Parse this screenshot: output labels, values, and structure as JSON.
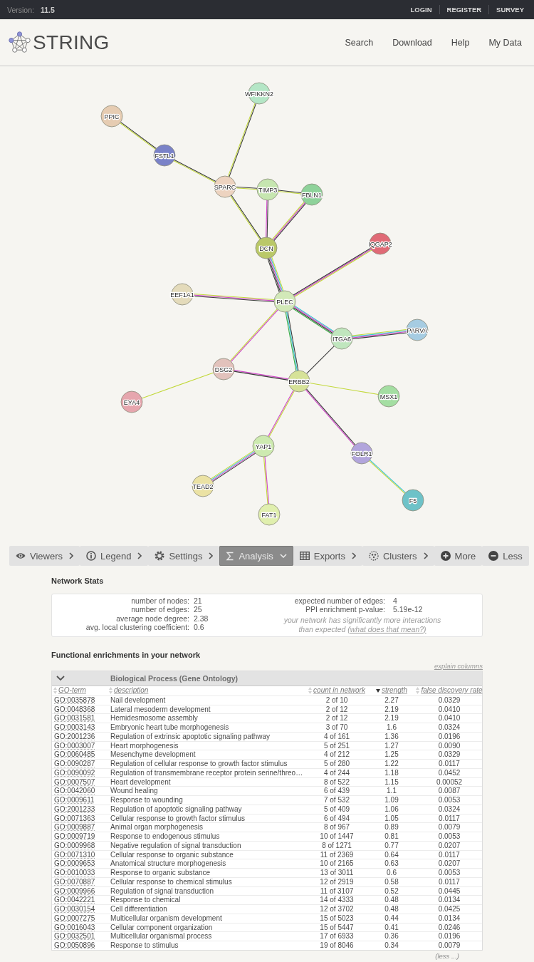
{
  "top_bar": {
    "version_label": "Version:",
    "version": "11.5",
    "links": [
      "LOGIN",
      "REGISTER",
      "SURVEY"
    ]
  },
  "header": {
    "logo": "STRING",
    "nav": [
      "Search",
      "Download",
      "Help",
      "My Data"
    ]
  },
  "network": {
    "nodes": [
      {
        "label": "WFIKKN2",
        "color": "#b4e6c6"
      },
      {
        "label": "PPIC",
        "color": "#e6ccb2"
      },
      {
        "label": "FSTL1",
        "color": "#7a82c8"
      },
      {
        "label": "SPARC",
        "color": "#edd3c0"
      },
      {
        "label": "TIMP3",
        "color": "#c6e6b0"
      },
      {
        "label": "FBLN1",
        "color": "#8ed29a"
      },
      {
        "label": "DCN",
        "color": "#bac868"
      },
      {
        "label": "IQGAP2",
        "color": "#e06a76"
      },
      {
        "label": "EEF1A1",
        "color": "#e4dbbb"
      },
      {
        "label": "PLEC",
        "color": "#d2e9b8"
      },
      {
        "label": "PARVA",
        "color": "#a6cce2"
      },
      {
        "label": "ITGA6",
        "color": "#c0e6be"
      },
      {
        "label": "DSG2",
        "color": "#e2c2bc"
      },
      {
        "label": "ERBB2",
        "color": "#d6e298"
      },
      {
        "label": "EYA4",
        "color": "#e6a6ae"
      },
      {
        "label": "MSX1",
        "color": "#a4dea2"
      },
      {
        "label": "YAP1",
        "color": "#cdeab0"
      },
      {
        "label": "FOLR1",
        "color": "#b2a5dc"
      },
      {
        "label": "TEAD2",
        "color": "#ebe2a4"
      },
      {
        "label": "F5",
        "color": "#6ec2c8"
      },
      {
        "label": "FAT1",
        "color": "#e0efae"
      }
    ]
  },
  "toolbar": {
    "buttons": [
      {
        "label": "Viewers",
        "kind": "menu",
        "selected": false
      },
      {
        "label": "Legend",
        "kind": "menu",
        "selected": false
      },
      {
        "label": "Settings",
        "kind": "menu",
        "selected": false
      },
      {
        "label": "Analysis",
        "kind": "menu",
        "selected": true
      },
      {
        "label": "Exports",
        "kind": "menu",
        "selected": false
      },
      {
        "label": "Clusters",
        "kind": "menu",
        "selected": false
      },
      {
        "label": "More",
        "kind": "action",
        "selected": false
      },
      {
        "label": "Less",
        "kind": "action",
        "selected": false
      }
    ]
  },
  "network_stats": {
    "title": "Network Stats",
    "left": [
      {
        "label": "number of nodes:",
        "value": "21"
      },
      {
        "label": "number of edges:",
        "value": "25"
      },
      {
        "label": "average node degree:",
        "value": "2.38"
      },
      {
        "label": "avg. local clustering coefficient:",
        "value": "0.6"
      }
    ],
    "right": [
      {
        "label": "expected number of edges:",
        "value": "4"
      },
      {
        "label": "PPI enrichment p-value:",
        "value": "5.19e-12"
      }
    ],
    "note": "your network has significantly more interactions than expected",
    "note_link": "(what does that mean?)"
  },
  "enrichments": {
    "title": "Functional enrichments in your network",
    "explain_link": "explain columns",
    "category": {
      "title": "Biological Process (Gene Ontology)",
      "expanded": true
    },
    "columns": [
      {
        "label": "GO-term",
        "sorted": false
      },
      {
        "label": "description",
        "sorted": false
      },
      {
        "label": "count in network",
        "sorted": false
      },
      {
        "label": "strength",
        "sorted": true
      },
      {
        "label": "false discovery rate",
        "sorted": false
      }
    ],
    "rows": [
      {
        "term": "GO:0035878",
        "description": "Nail development",
        "count": "2 of 10",
        "strength": "2.27",
        "fdr": "0.0329"
      },
      {
        "term": "GO:0048368",
        "description": "Lateral mesoderm development",
        "count": "2 of 12",
        "strength": "2.19",
        "fdr": "0.0410"
      },
      {
        "term": "GO:0031581",
        "description": "Hemidesmosome assembly",
        "count": "2 of 12",
        "strength": "2.19",
        "fdr": "0.0410"
      },
      {
        "term": "GO:0003143",
        "description": "Embryonic heart tube morphogenesis",
        "count": "3 of 70",
        "strength": "1.6",
        "fdr": "0.0324"
      },
      {
        "term": "GO:2001236",
        "description": "Regulation of extrinsic apoptotic signaling pathway",
        "count": "4 of 161",
        "strength": "1.36",
        "fdr": "0.0196"
      },
      {
        "term": "GO:0003007",
        "description": "Heart morphogenesis",
        "count": "5 of 251",
        "strength": "1.27",
        "fdr": "0.0090"
      },
      {
        "term": "GO:0060485",
        "description": "Mesenchyme development",
        "count": "4 of 212",
        "strength": "1.25",
        "fdr": "0.0329"
      },
      {
        "term": "GO:0090287",
        "description": "Regulation of cellular response to growth factor stimulus",
        "count": "5 of 280",
        "strength": "1.22",
        "fdr": "0.0117"
      },
      {
        "term": "GO:0090092",
        "description": "Regulation of transmembrane receptor protein serine/threo…",
        "count": "4 of 244",
        "strength": "1.18",
        "fdr": "0.0452"
      },
      {
        "term": "GO:0007507",
        "description": "Heart development",
        "count": "8 of 522",
        "strength": "1.15",
        "fdr": "0.00052"
      },
      {
        "term": "GO:0042060",
        "description": "Wound healing",
        "count": "6 of 439",
        "strength": "1.1",
        "fdr": "0.0087"
      },
      {
        "term": "GO:0009611",
        "description": "Response to wounding",
        "count": "7 of 532",
        "strength": "1.09",
        "fdr": "0.0053"
      },
      {
        "term": "GO:2001233",
        "description": "Regulation of apoptotic signaling pathway",
        "count": "5 of 409",
        "strength": "1.06",
        "fdr": "0.0324"
      },
      {
        "term": "GO:0071363",
        "description": "Cellular response to growth factor stimulus",
        "count": "6 of 494",
        "strength": "1.05",
        "fdr": "0.0117"
      },
      {
        "term": "GO:0009887",
        "description": "Animal organ morphogenesis",
        "count": "8 of 967",
        "strength": "0.89",
        "fdr": "0.0079"
      },
      {
        "term": "GO:0009719",
        "description": "Response to endogenous stimulus",
        "count": "10 of 1447",
        "strength": "0.81",
        "fdr": "0.0053"
      },
      {
        "term": "GO:0009968",
        "description": "Negative regulation of signal transduction",
        "count": "8 of 1271",
        "strength": "0.77",
        "fdr": "0.0207"
      },
      {
        "term": "GO:0071310",
        "description": "Cellular response to organic substance",
        "count": "11 of 2369",
        "strength": "0.64",
        "fdr": "0.0117"
      },
      {
        "term": "GO:0009653",
        "description": "Anatomical structure morphogenesis",
        "count": "10 of 2165",
        "strength": "0.63",
        "fdr": "0.0207"
      },
      {
        "term": "GO:0010033",
        "description": "Response to organic substance",
        "count": "13 of 3011",
        "strength": "0.6",
        "fdr": "0.0053"
      },
      {
        "term": "GO:0070887",
        "description": "Cellular response to chemical stimulus",
        "count": "12 of 2919",
        "strength": "0.58",
        "fdr": "0.0117"
      },
      {
        "term": "GO:0009966",
        "description": "Regulation of signal transduction",
        "count": "11 of 3107",
        "strength": "0.52",
        "fdr": "0.0445"
      },
      {
        "term": "GO:0042221",
        "description": "Response to chemical",
        "count": "14 of 4333",
        "strength": "0.48",
        "fdr": "0.0134"
      },
      {
        "term": "GO:0030154",
        "description": "Cell differentiation",
        "count": "12 of 3702",
        "strength": "0.48",
        "fdr": "0.0425"
      },
      {
        "term": "GO:0007275",
        "description": "Multicellular organism development",
        "count": "15 of 5023",
        "strength": "0.44",
        "fdr": "0.0134"
      },
      {
        "term": "GO:0016043",
        "description": "Cellular component organization",
        "count": "15 of 5447",
        "strength": "0.41",
        "fdr": "0.0246"
      },
      {
        "term": "GO:0032501",
        "description": "Multicellular organismal process",
        "count": "17 of 6933",
        "strength": "0.36",
        "fdr": "0.0196"
      },
      {
        "term": "GO:0050896",
        "description": "Response to stimulus",
        "count": "19 of 8046",
        "strength": "0.34",
        "fdr": "0.0079"
      }
    ],
    "less_link": "(less ...)"
  }
}
